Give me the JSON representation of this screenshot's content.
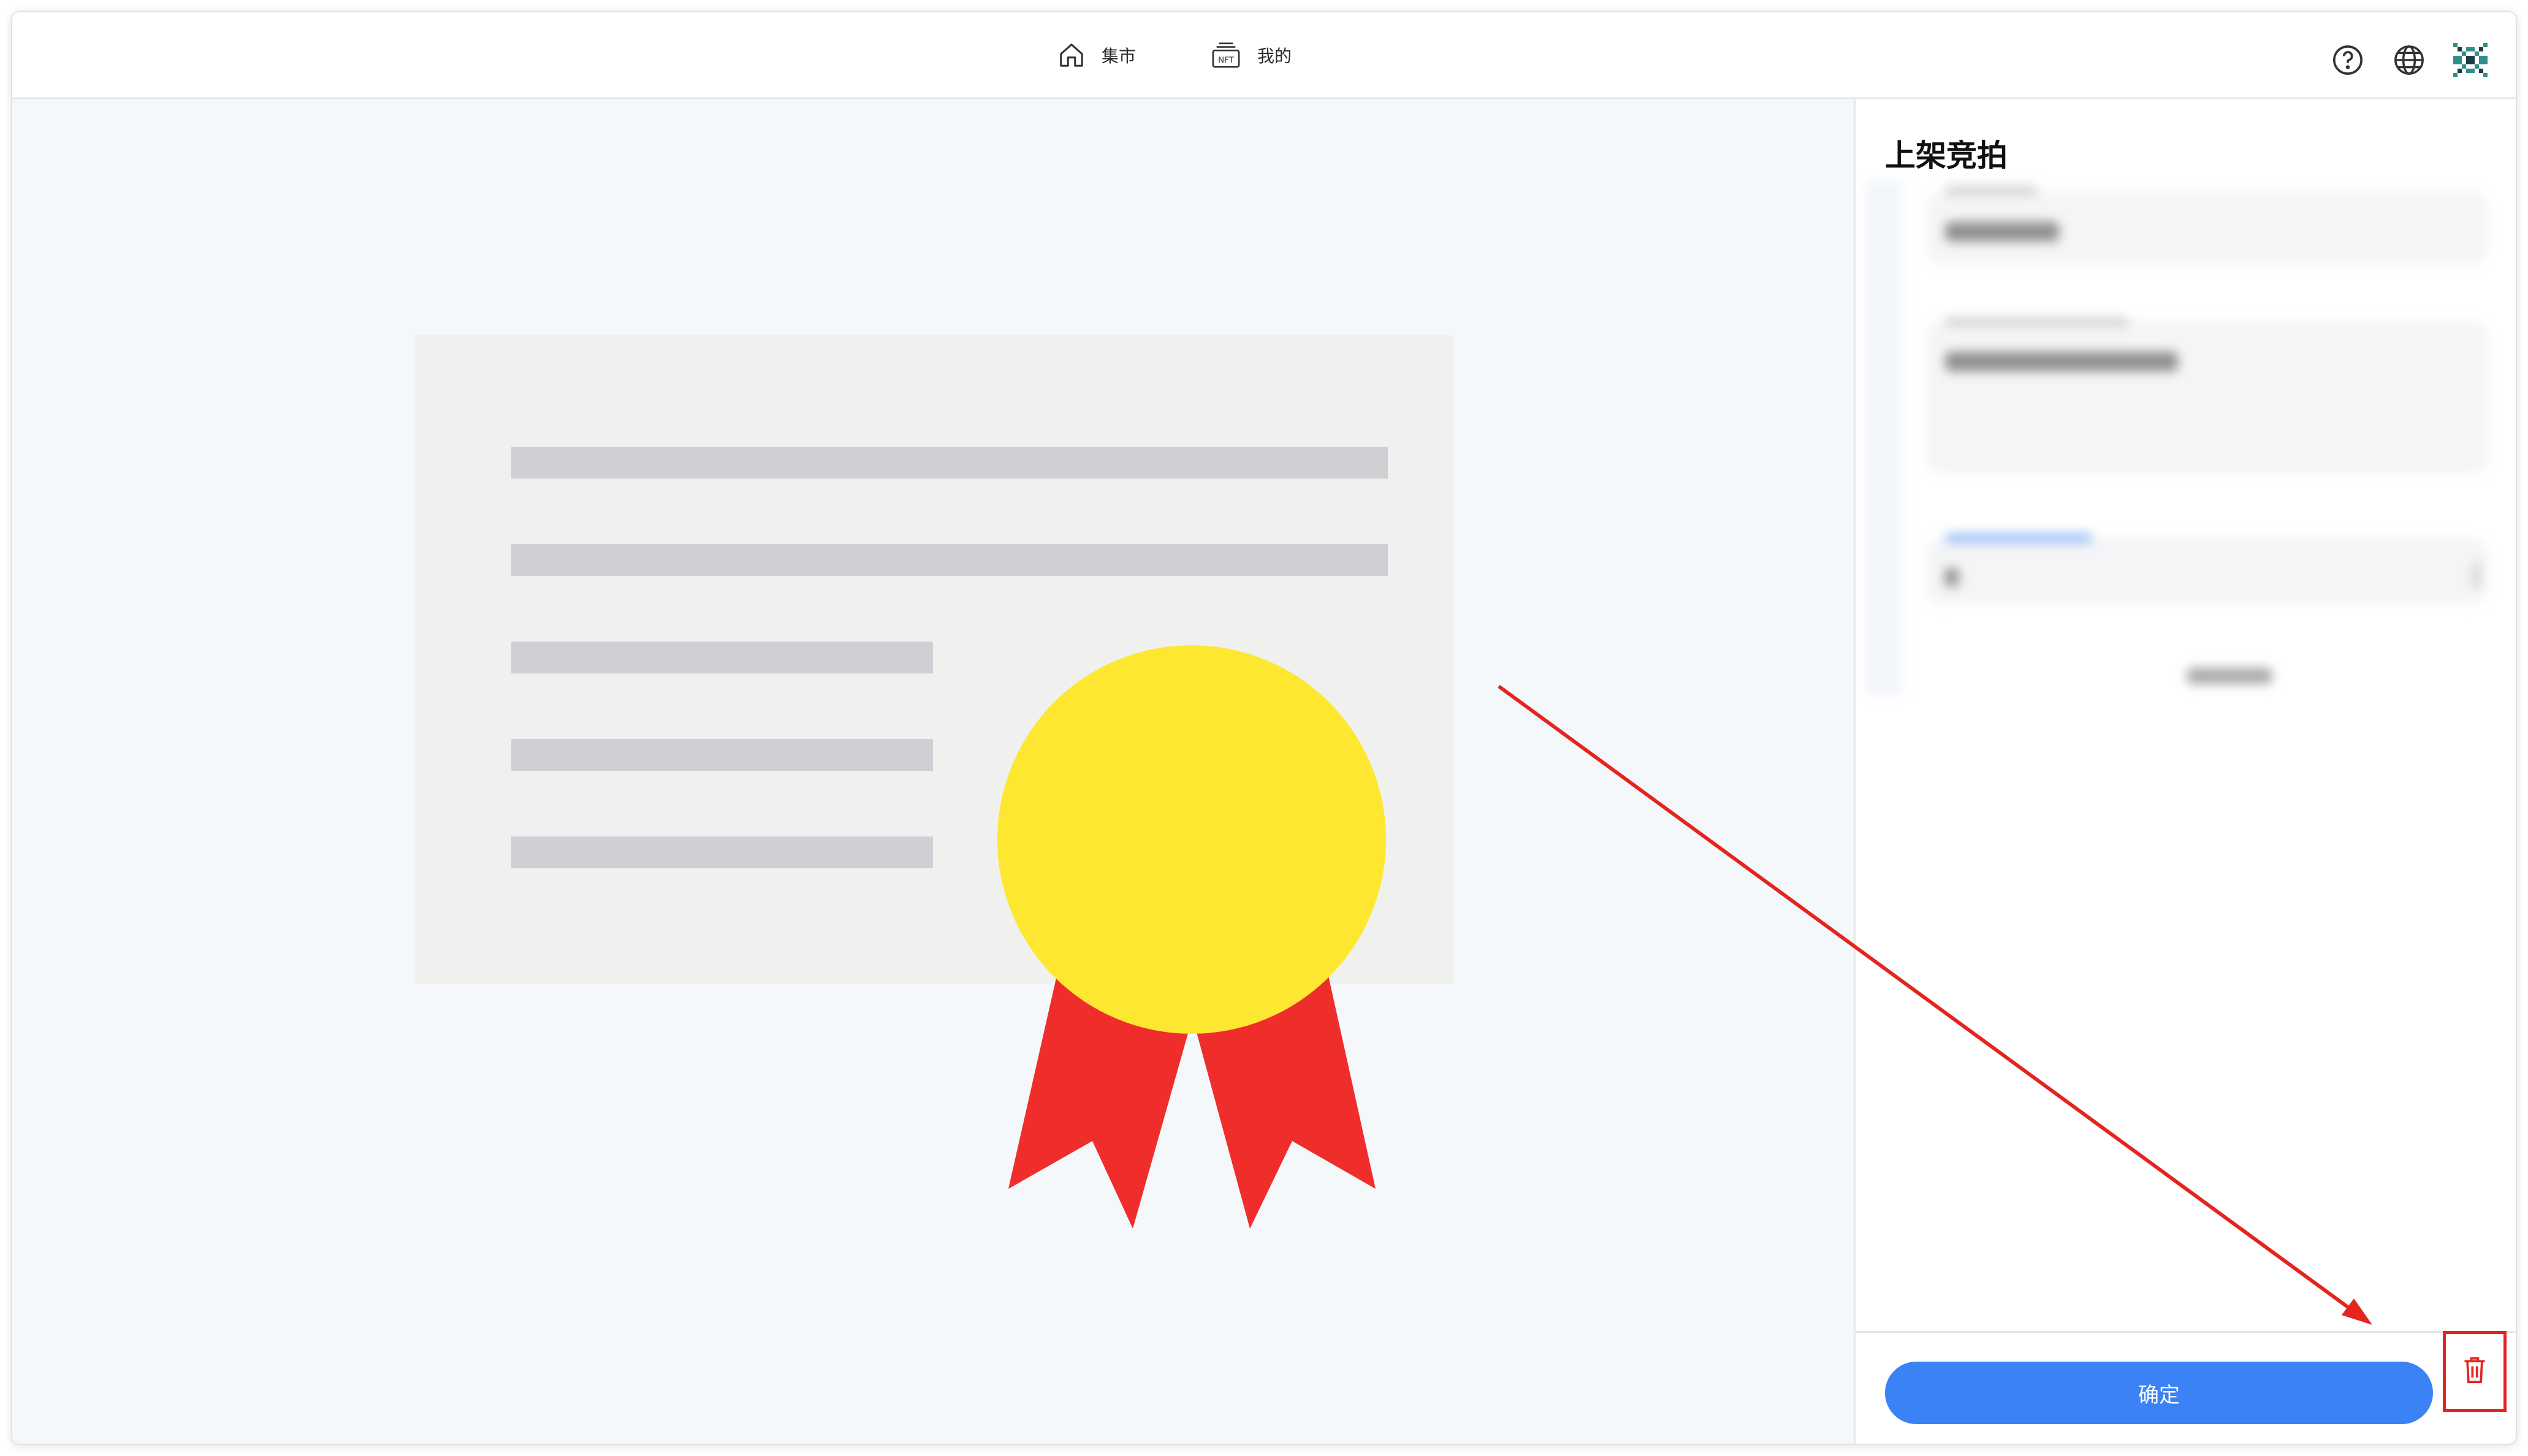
{
  "nav": {
    "items": [
      {
        "label": "集市",
        "icon": "home-icon"
      },
      {
        "label": "我的",
        "icon": "nft-icon"
      }
    ],
    "right_icons": [
      "help-icon",
      "globe-icon",
      "avatar-icon"
    ],
    "nft_icon_text": "NFT"
  },
  "panel": {
    "title": "上架竞拍",
    "confirm_label": "确定"
  },
  "colors": {
    "accent": "#3a82f6",
    "annotation": "#e52420",
    "medal": "#fde731",
    "ribbon": "#ef2e2c"
  }
}
